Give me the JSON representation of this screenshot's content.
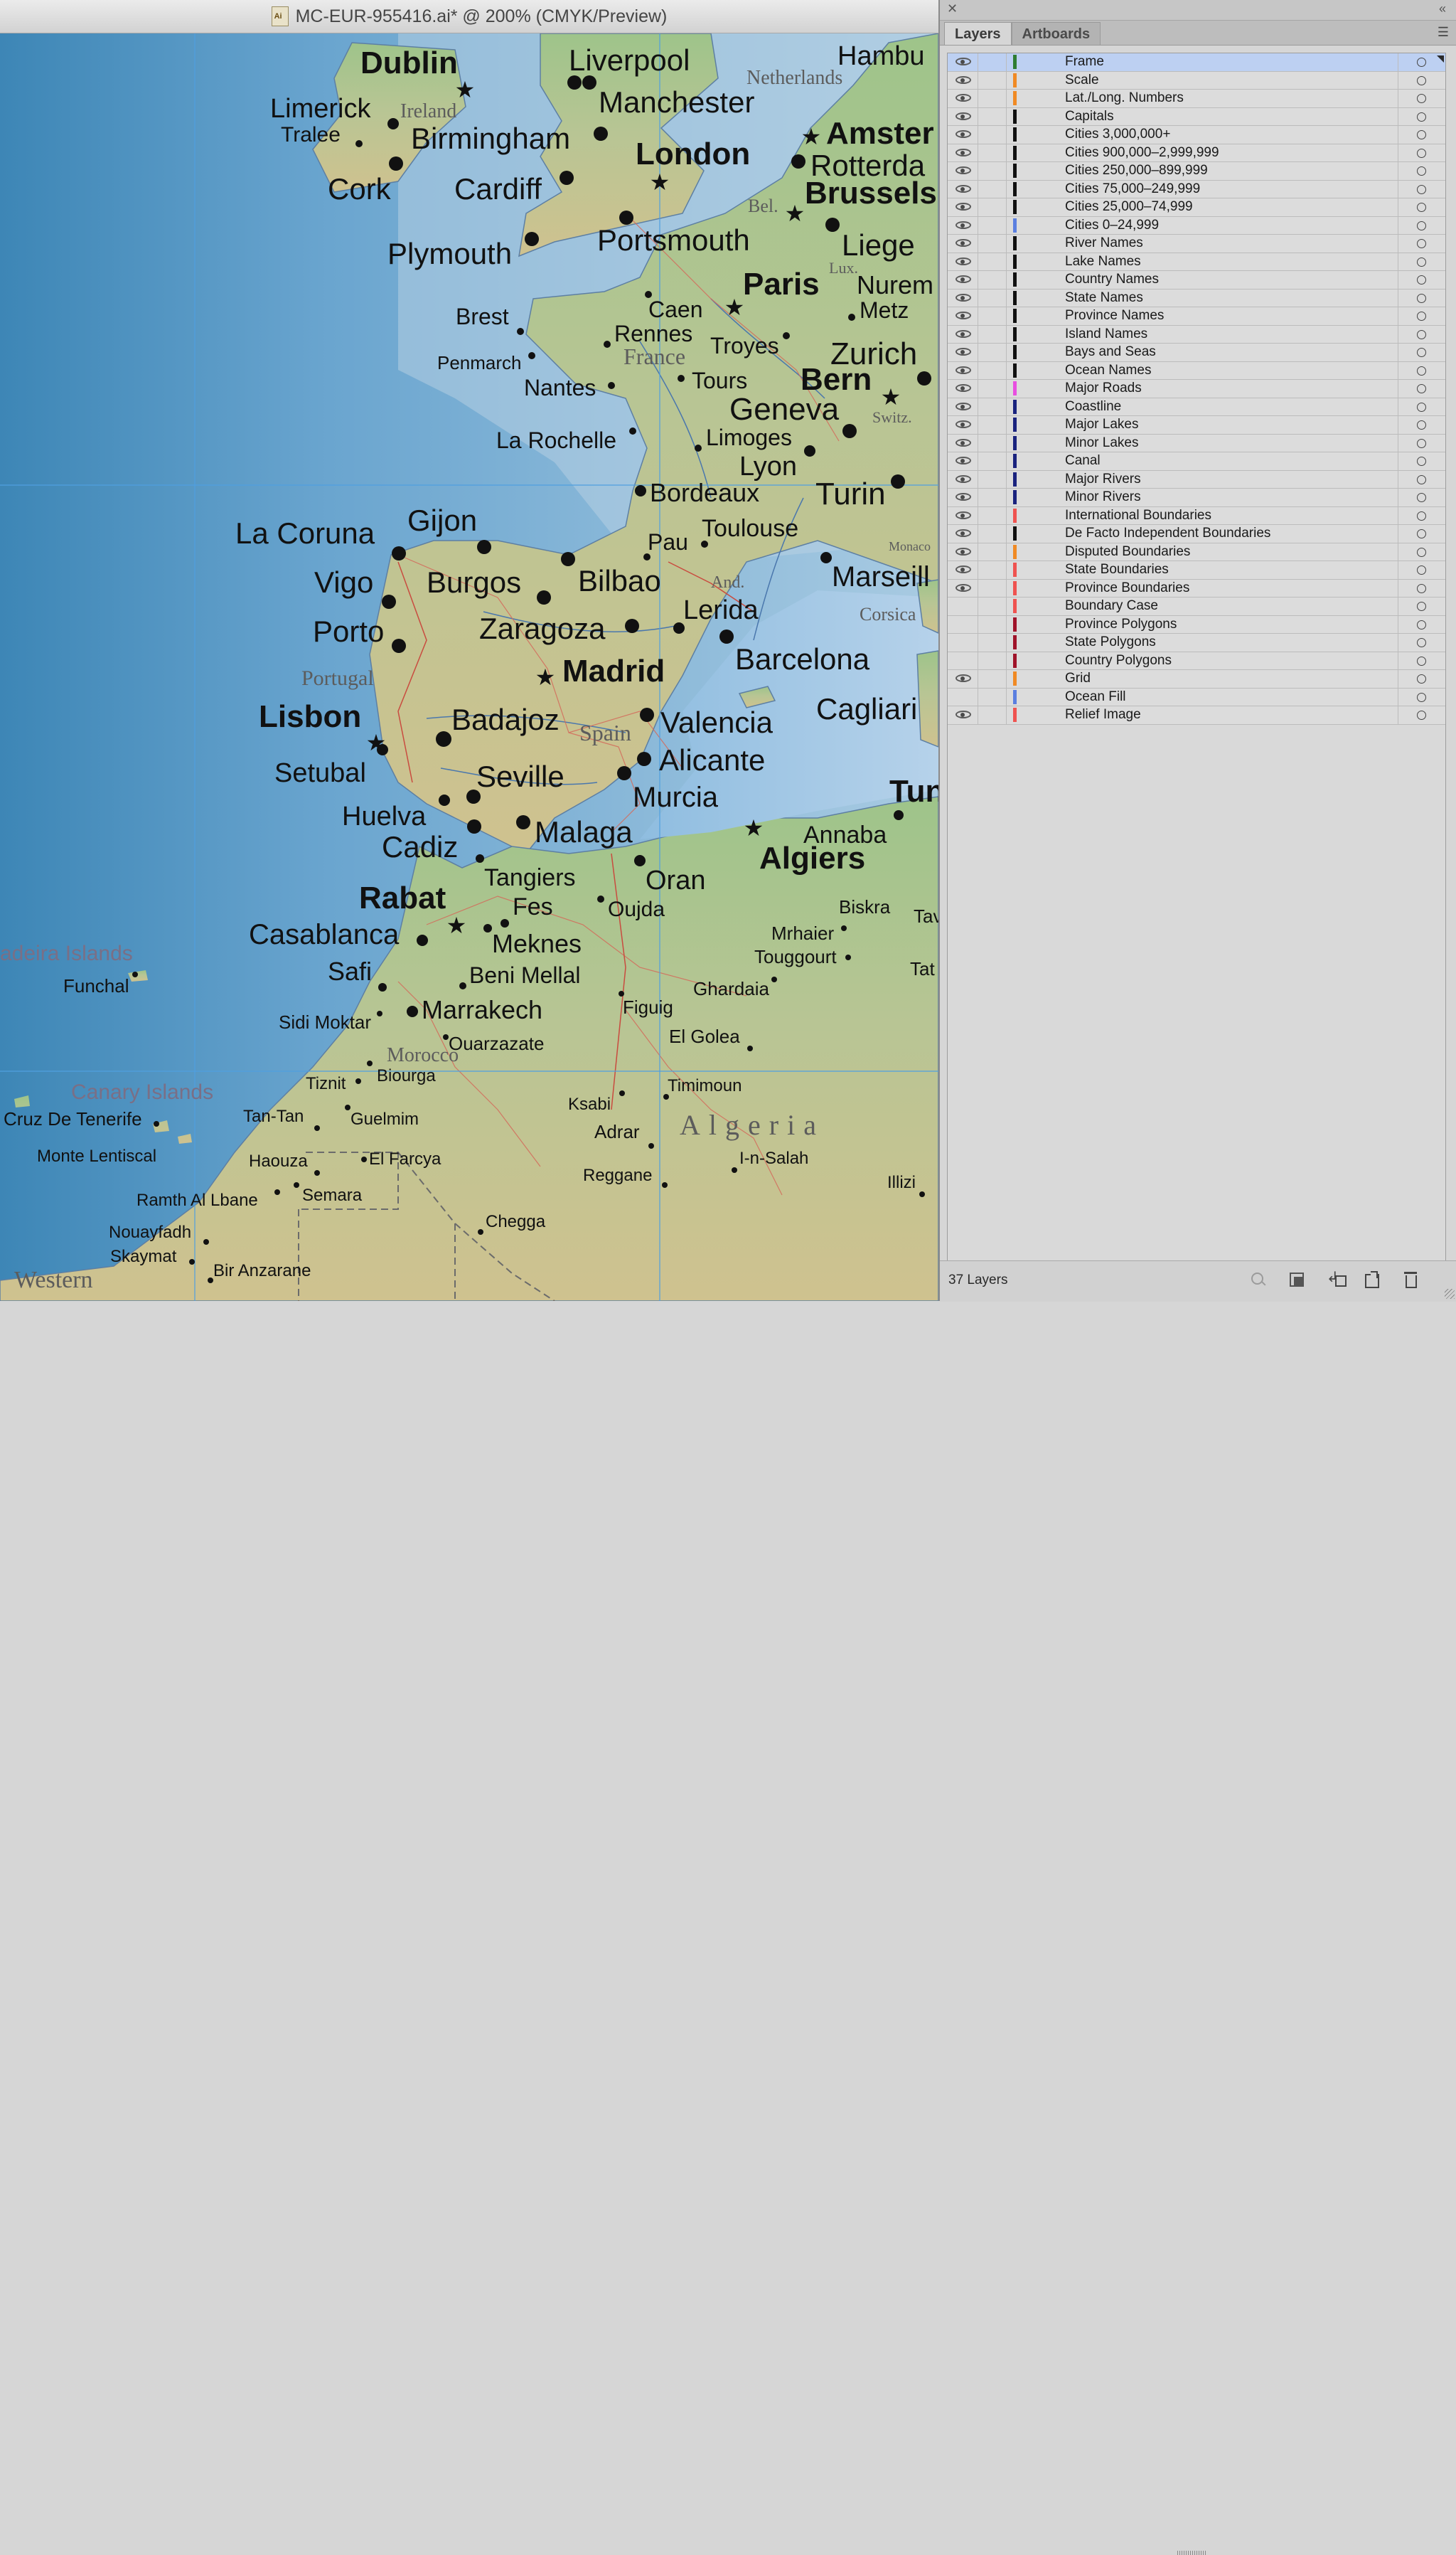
{
  "document": {
    "title": "MC-EUR-955416.ai* @ 200% (CMYK/Preview)"
  },
  "map": {
    "labels": {
      "capitals": [
        "Dublin",
        "London",
        "Amster",
        "Brussels",
        "Paris",
        "Bern",
        "Madrid",
        "Lisbon",
        "Rabat",
        "Algiers",
        "Tun"
      ],
      "cities": [
        "Liverpool",
        "Hambu",
        "Manchester",
        "Limerick",
        "Tralee",
        "Birmingham",
        "Cork",
        "Cardiff",
        "Rotterda",
        "Plymouth",
        "Portsmouth",
        "Liege",
        "Nurem",
        "Brest",
        "Caen",
        "Metz",
        "Rennes",
        "Penmarch",
        "Troyes",
        "Zurich",
        "Nantes",
        "Tours",
        "Geneva",
        "La Rochelle",
        "Limoges",
        "Lyon",
        "Bordeaux",
        "Turin",
        "Gijon",
        "La Coruna",
        "Toulouse",
        "Pau",
        "Marseill",
        "Vigo",
        "Burgos",
        "Bilbao",
        "Lerida",
        "Porto",
        "Zaragoza",
        "Barcelona",
        "Cagliari",
        "Badajoz",
        "Valencia",
        "Setubal",
        "Seville",
        "Alicante",
        "Murcia",
        "Huelva",
        "Malaga",
        "Annaba",
        "Cadiz",
        "Tangiers",
        "Oran",
        "Fes",
        "Oujda",
        "Biskra",
        "Tav",
        "Casablanca",
        "Meknes",
        "Mrhaier",
        "Touggourt",
        "Tat",
        "Funchal",
        "Safi",
        "Beni Mellal",
        "Ghardaia",
        "Marrakech",
        "Figuig",
        "Sidi Moktar",
        "Ouarzazate",
        "El Golea",
        "Tiznit",
        "Biourga",
        "Timimoun",
        "Cruz De Tenerife",
        "Tan-Tan",
        "Guelmim",
        "Ksabi",
        "Adrar",
        "Monte Lentiscal",
        "Haouza",
        "El Farcya",
        "I-n-Salah",
        "Reggane",
        "Illizi",
        "Ramth Al Lbane",
        "Semara",
        "Chegga",
        "Nouayfadh",
        "Skaymat",
        "Bir Anzarane"
      ],
      "countries": [
        "Ireland",
        "Netherlands",
        "Bel.",
        "Lux.",
        "France",
        "Switz.",
        "Monaco",
        "And.",
        "Corsica",
        "Portugal",
        "Spain",
        "Morocco",
        "Algeria",
        "Western"
      ],
      "islands": [
        "adeira Islands",
        "Canary Islands"
      ]
    }
  },
  "panel": {
    "tabs": [
      "Layers",
      "Artboards"
    ],
    "layer_count": "37 Layers",
    "layers": [
      {
        "name": "Frame",
        "color": "#2e7d32",
        "visible": true,
        "selected": true
      },
      {
        "name": "Scale",
        "color": "#f08a24",
        "visible": true
      },
      {
        "name": "Lat./Long. Numbers",
        "color": "#f08a24",
        "visible": true
      },
      {
        "name": "Capitals",
        "color": "#111111",
        "visible": true
      },
      {
        "name": "Cities 3,000,000+",
        "color": "#111111",
        "visible": true
      },
      {
        "name": "Cities 900,000–2,999,999",
        "color": "#111111",
        "visible": true
      },
      {
        "name": "Cities 250,000–899,999",
        "color": "#111111",
        "visible": true
      },
      {
        "name": "Cities 75,000–249,999",
        "color": "#111111",
        "visible": true
      },
      {
        "name": "Cities 25,000–74,999",
        "color": "#111111",
        "visible": true
      },
      {
        "name": "Cities 0–24,999",
        "color": "#5b7fe0",
        "visible": true
      },
      {
        "name": "River Names",
        "color": "#111111",
        "visible": true
      },
      {
        "name": "Lake Names",
        "color": "#111111",
        "visible": true
      },
      {
        "name": "Country Names",
        "color": "#111111",
        "visible": true
      },
      {
        "name": "State Names",
        "color": "#111111",
        "visible": true
      },
      {
        "name": "Province Names",
        "color": "#111111",
        "visible": true
      },
      {
        "name": "Island Names",
        "color": "#111111",
        "visible": true
      },
      {
        "name": "Bays and Seas",
        "color": "#111111",
        "visible": true
      },
      {
        "name": "Ocean Names",
        "color": "#111111",
        "visible": true
      },
      {
        "name": "Major Roads",
        "color": "#e84fe0",
        "visible": true
      },
      {
        "name": "Coastline",
        "color": "#1a237e",
        "visible": true
      },
      {
        "name": "Major Lakes",
        "color": "#1a237e",
        "visible": true
      },
      {
        "name": "Minor Lakes",
        "color": "#1a237e",
        "visible": true
      },
      {
        "name": "Canal",
        "color": "#1a237e",
        "visible": true
      },
      {
        "name": "Major Rivers",
        "color": "#1a237e",
        "visible": true
      },
      {
        "name": "Minor Rivers",
        "color": "#1a237e",
        "visible": true
      },
      {
        "name": "International Boundaries",
        "color": "#ef5350",
        "visible": true
      },
      {
        "name": "De Facto Independent Boundaries",
        "color": "#111111",
        "visible": true
      },
      {
        "name": "Disputed Boundaries",
        "color": "#f08a24",
        "visible": true
      },
      {
        "name": "State Boundaries",
        "color": "#ef5350",
        "visible": true
      },
      {
        "name": "Province Boundaries",
        "color": "#ef5350",
        "visible": true
      },
      {
        "name": "Boundary Case",
        "color": "#ef5350",
        "visible": false
      },
      {
        "name": "Province Polygons",
        "color": "#a0132a",
        "visible": false
      },
      {
        "name": "State Polygons",
        "color": "#a0132a",
        "visible": false
      },
      {
        "name": "Country Polygons",
        "color": "#a0132a",
        "visible": false
      },
      {
        "name": "Grid",
        "color": "#f08a24",
        "visible": true
      },
      {
        "name": "Ocean Fill",
        "color": "#5b7fe0",
        "visible": false
      },
      {
        "name": "Relief Image",
        "color": "#ef5350",
        "visible": true
      }
    ]
  }
}
